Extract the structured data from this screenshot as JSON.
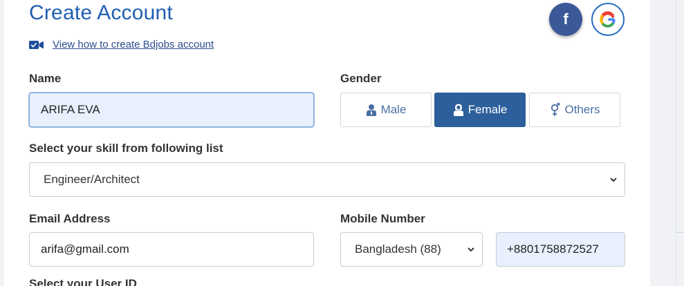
{
  "title": "Create Account",
  "video_link": "View how to create Bdjobs account",
  "social": {
    "facebook": "f",
    "google": "G"
  },
  "name": {
    "label": "Name",
    "value": "ARIFA EVA"
  },
  "gender": {
    "label": "Gender",
    "options": [
      {
        "label": "Male",
        "icon": "male-user-icon",
        "selected": false
      },
      {
        "label": "Female",
        "icon": "female-user-icon",
        "selected": true
      },
      {
        "label": "Others",
        "icon": "gender-symbol-icon",
        "selected": false
      }
    ]
  },
  "skill": {
    "label": "Select your skill from following list",
    "value": "Engineer/Architect"
  },
  "email": {
    "label": "Email Address",
    "value": "arifa@gmail.com"
  },
  "mobile": {
    "label": "Mobile Number",
    "country": "Bangladesh (88)",
    "value": "+8801758872527"
  },
  "userid": {
    "label": "Select your User ID"
  },
  "colors": {
    "brand": "#1f5fb0",
    "selected": "#2c5f9b",
    "facebook": "#3b5998"
  }
}
